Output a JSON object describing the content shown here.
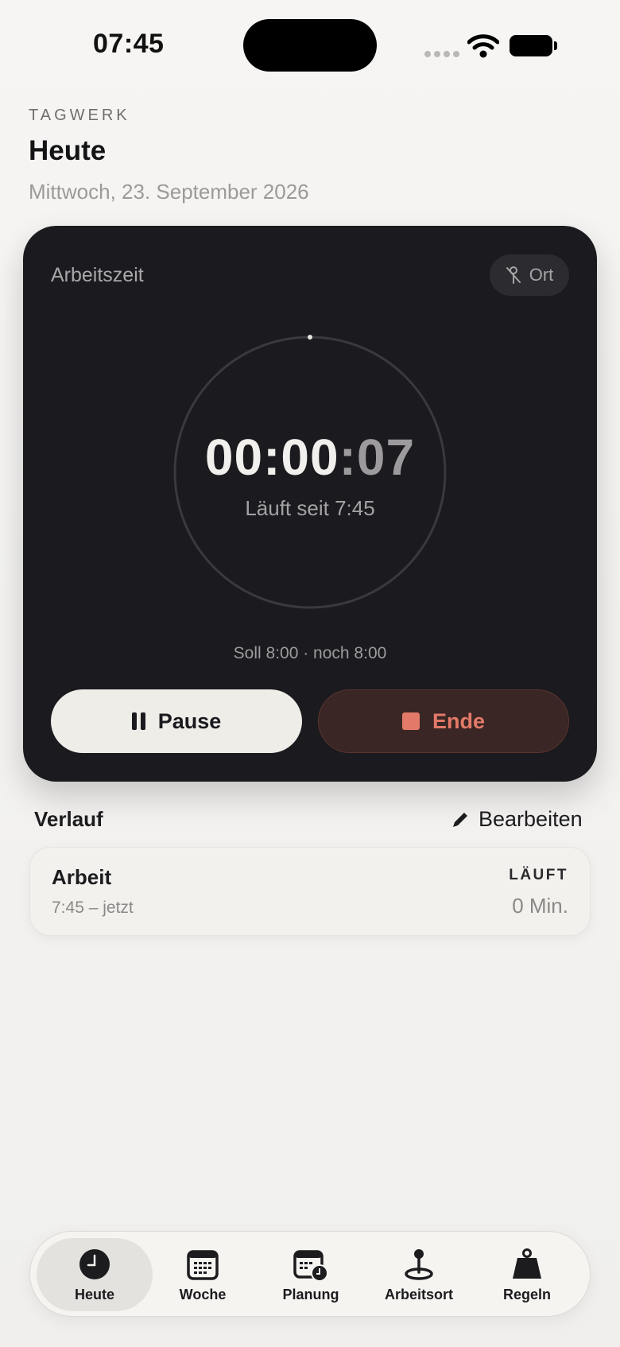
{
  "status_bar": {
    "time": "07:45"
  },
  "header": {
    "kicker": "TAGWERK",
    "title": "Heute",
    "date": "Mittwoch, 23. September 2026"
  },
  "timer_card": {
    "label": "Arbeitszeit",
    "location_chip": "Ort",
    "elapsed_hm": "00:00",
    "elapsed_s": ":07",
    "running_since": "Läuft seit 7:45",
    "target": "Soll 8:00 · noch 8:00",
    "pause_label": "Pause",
    "end_label": "Ende"
  },
  "history": {
    "title": "Verlauf",
    "edit_label": "Bearbeiten",
    "entries": [
      {
        "type": "Arbeit",
        "time": "7:45 – jetzt",
        "status": "LÄUFT",
        "duration": "0 Min."
      }
    ]
  },
  "tabs": [
    {
      "label": "Heute",
      "icon": "clock-icon",
      "active": true
    },
    {
      "label": "Woche",
      "icon": "calendar-icon",
      "active": false
    },
    {
      "label": "Planung",
      "icon": "calendar-clock-icon",
      "active": false
    },
    {
      "label": "Arbeitsort",
      "icon": "location-pin-icon",
      "active": false
    },
    {
      "label": "Regeln",
      "icon": "weight-icon",
      "active": false
    }
  ],
  "colors": {
    "card_bg": "#1b1a1e",
    "end_accent": "#e37a69",
    "page_bg": "#f6f5f3"
  }
}
